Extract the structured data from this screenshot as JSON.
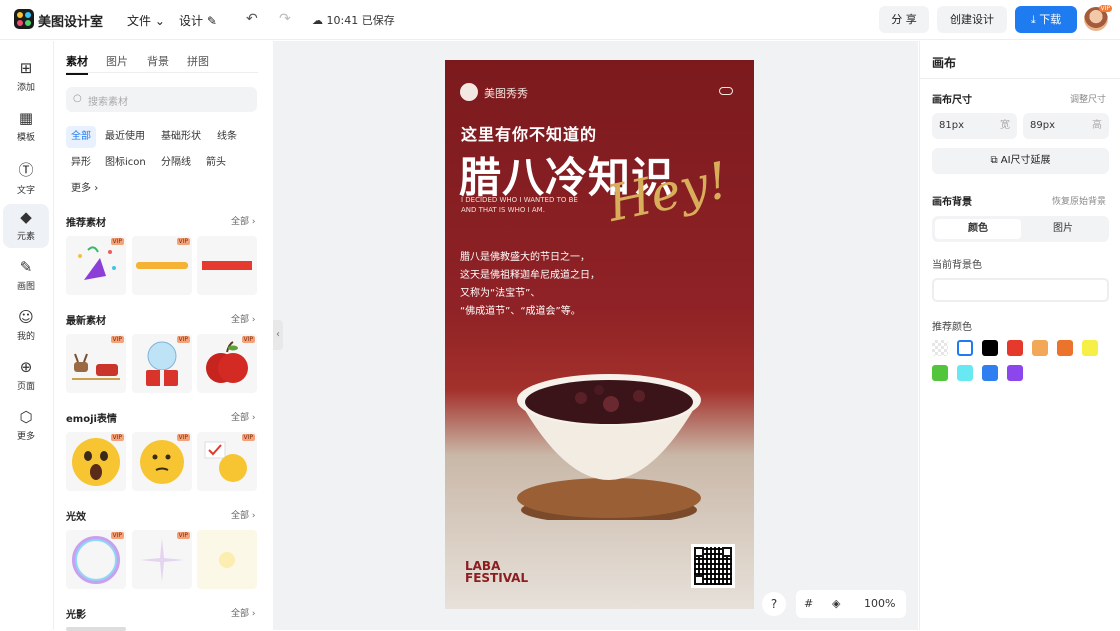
{
  "top": {
    "app_title": "美图设计室",
    "menu_file": "文件",
    "menu_design": "设计",
    "saved_status": "10:41 已保存",
    "share_label": "分 享",
    "create_label": "创建设计",
    "download_label": "下载",
    "avatar_badge": "VIP"
  },
  "rail": [
    {
      "label": "添加",
      "icon": "plus-square-icon"
    },
    {
      "label": "模板",
      "icon": "template-icon"
    },
    {
      "label": "文字",
      "icon": "text-icon"
    },
    {
      "label": "元素",
      "icon": "element-icon"
    },
    {
      "label": "画图",
      "icon": "draw-icon"
    },
    {
      "label": "我的",
      "icon": "user-icon"
    },
    {
      "label": "页面",
      "icon": "page-add-icon"
    },
    {
      "label": "更多",
      "icon": "cube-icon"
    }
  ],
  "panel": {
    "tabs": [
      "素材",
      "图片",
      "背景",
      "拼图"
    ],
    "search_placeholder": "搜索素材",
    "chips": [
      "全部",
      "最近使用",
      "基础形状",
      "线条",
      "异形",
      "图标icon",
      "分隔线",
      "箭头",
      "更多"
    ],
    "sections": [
      {
        "title": "推荐素材",
        "all": "全部"
      },
      {
        "title": "最新素材",
        "all": "全部"
      },
      {
        "title": "emoji表情",
        "all": "全部"
      },
      {
        "title": "光效",
        "all": "全部"
      },
      {
        "title": "光影",
        "all": "全部"
      }
    ],
    "vip": "VIP"
  },
  "poster": {
    "brand": "美图秀秀",
    "subtitle": "这里有你不知道的",
    "title": "腊八冷知识",
    "english_1": "I DECIDED WHO I WANTED TO BE",
    "english_2": "AND THAT IS WHO I AM.",
    "hey": "Hey!",
    "body": [
      "腊八是佛教盛大的节日之一，",
      "这天是佛祖释迦牟尼成道之日，",
      "又称为“法宝节”、",
      "“佛成道节”、“成道会”等。"
    ],
    "laba_1": "LABA",
    "laba_2": "FESTIVAL"
  },
  "zoom": {
    "help": "?",
    "value": "100%"
  },
  "right": {
    "title": "画布",
    "size_label": "画布尺寸",
    "adjust_link": "调整尺寸",
    "width_value": "81px",
    "width_unit": "宽",
    "height_value": "89px",
    "height_unit": "高",
    "ai_button": "AI尺寸延展",
    "bg_label": "画布背景",
    "restore_link": "恢复原始背景",
    "seg_color": "颜色",
    "seg_image": "图片",
    "current_bg_label": "当前背景色",
    "recommend_label": "推荐颜色",
    "swatches": [
      "transparent",
      "#ffffff",
      "#000000",
      "#e53a2b",
      "#f3a857",
      "#ec732b",
      "#f6ef45",
      "#52c53d",
      "#67e8f2",
      "#2f7ff0",
      "#8b46ec"
    ]
  }
}
